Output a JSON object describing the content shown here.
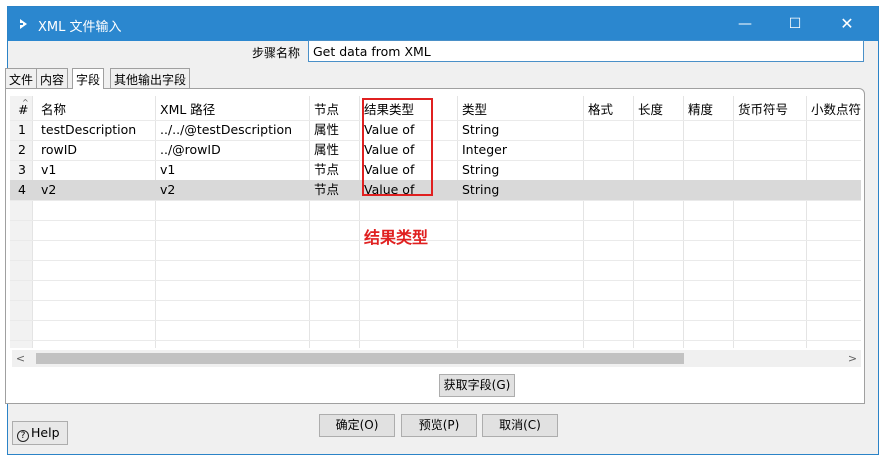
{
  "window": {
    "title": "XML 文件输入",
    "min_glyph": "—",
    "max_glyph": "☐",
    "close_glyph": "✕"
  },
  "step": {
    "label": "步骤名称",
    "value": "Get data from XML"
  },
  "tabs": [
    {
      "label": "文件",
      "active": false
    },
    {
      "label": "内容",
      "active": false
    },
    {
      "label": "字段",
      "active": true
    },
    {
      "label": "其他输出字段",
      "active": false
    }
  ],
  "grid": {
    "columns": [
      "#",
      "名称",
      "XML 路径",
      "节点",
      "结果类型",
      "类型",
      "格式",
      "长度",
      "精度",
      "货币符号",
      "小数点符"
    ],
    "rows": [
      [
        "1",
        "testDescription",
        "../../@testDescription",
        "属性",
        "Value of",
        "String"
      ],
      [
        "2",
        "rowID",
        "../@rowID",
        "属性",
        "Value of",
        "Integer"
      ],
      [
        "3",
        "v1",
        "v1",
        "节点",
        "Value of",
        "String"
      ],
      [
        "4",
        "v2",
        "v2",
        "节点",
        "Value of",
        "String"
      ]
    ],
    "selected_row": 3
  },
  "annotation": {
    "note": "结果类型",
    "color": "#e02020"
  },
  "scroll": {
    "left_arrow": "<",
    "right_arrow": ">"
  },
  "buttons": {
    "get_fields": "获取字段(G)",
    "ok": "确定(O)",
    "preview": "预览(P)",
    "cancel": "取消(C)",
    "help": "Help"
  },
  "accent_color": "#2b87cf"
}
